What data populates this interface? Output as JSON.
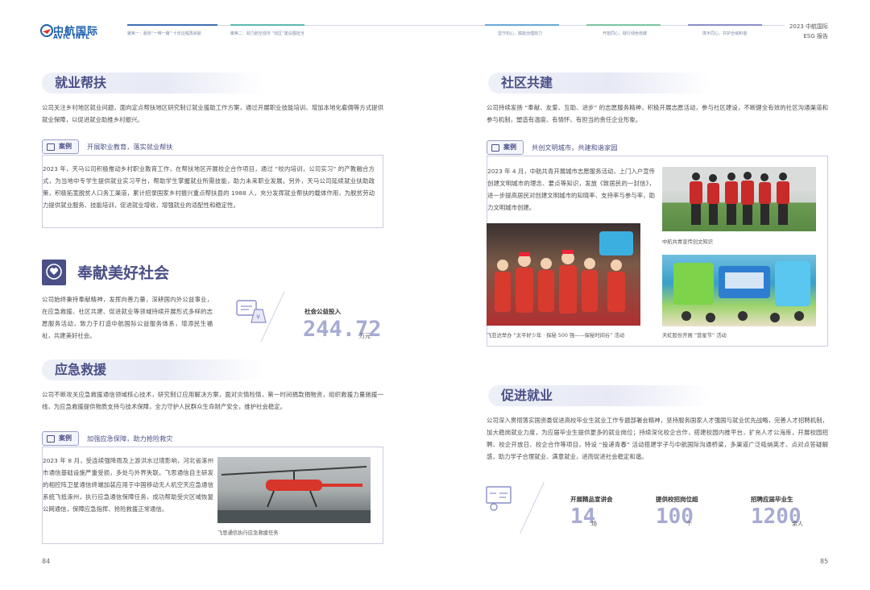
{
  "header": {
    "logo_cn": "中航国际",
    "logo_en": "AVIC INTL",
    "report_year": "2023 中航国际",
    "report_name": "ESG 报告",
    "nav": [
      {
        "label": "聚焦一：服务“一带一路” 十年征程再启航",
        "color": "#3f6fb4"
      },
      {
        "label": "聚焦二：助力航空强市 “双区”建设展担当",
        "color": "#5bb8b0"
      },
      {
        "label": "坚守初心，赋能治理效力",
        "color": "#6aa9d8"
      },
      {
        "label": "开拓同心，践行绿色低碳",
        "color": "#7cc4a2"
      },
      {
        "label": "携手同心，共护全域和谐",
        "color": "#8b8fc9"
      }
    ]
  },
  "left": {
    "employment_help": {
      "title": "就业帮扶",
      "intro": "公司关注乡村地区就业问题，面向定点帮扶地区研究制订就业援助工作方案，通过开展职业技能培训、增加本地化雇佣等方式提供就业保障，以促进就业助推乡村振兴。",
      "case_tag": "案例",
      "case_title": "开展职业教育，落实就业帮扶",
      "case_text": "2023 年，天马公司积极推动乡村职业教育工作，在帮扶地区开展校企合作项目，通过 “校内培训，公司实习” 的产教融合方式，为当地中专学生提供就业实习平台，帮助学生掌握就业所需技能，助力未来职业发展。另外，天马公司延续就业扶助政策，积极拓宽脱贫人口务工渠道，累计招录国家乡村振兴重点帮扶县的 1988 人，充分发挥就业帮扶的载体作用，为脱贫劳动力提供就业服务、技能培训，促进就业增收，增强就业的适配性和稳定性。"
    },
    "society": {
      "title": "奉献美好社会",
      "intro": "公司始终秉持奉献精神，发挥向善力量，深耕国内外公益事业，在应急救援、社区共建、促进就业等领域持续开展形式多样的志愿服务活动，致力于打造中航国际公益服务体系，增添民生福祉，共建美好社会。",
      "stat_label": "社会公益投入",
      "stat_value": "244.72",
      "stat_unit": "万元"
    },
    "emergency": {
      "title": "应急救援",
      "intro": "公司不断攻关应急救援通信领域核心技术，研究制订应用解决方案，面对灾情险情，第一时间捐款捐物资，组织救援力量驰援一线，为应急救援提供物质支持与技术保障，全力守护人民群众生命财产安全，维护社会稳定。",
      "case_tag": "案例",
      "case_title": "加强应急保障，助力抢险救灾",
      "case_text": "2023 年 8 月，受连续强降雨及上游洪水过境影响，河北省涿州市通信基础设施严重受损，多处与外界失联。飞思通信自主研发的相控阵卫星通信终端加装应用于中国移动无人机空天应急通信系统飞抵涿州，执行应急通信保障任务，成功帮助受灾区域恢复公网通信，保障应急指挥、抢险救援正常通信。",
      "photo_caption": "飞思通信执行应急救援任务"
    },
    "page_number": "84"
  },
  "right": {
    "community": {
      "title": "社区共建",
      "intro": "公司持续发扬 “奉献、友爱、互助、进步” 的志愿服务精神，积极开展志愿活动，参与社区建设，不断健全有效的社区沟通渠道和参与机制，塑造有温度、有情怀、有担当的责任企业形象。",
      "case_tag": "案例",
      "case_title": "共创文明城市，共建和谐家园",
      "case_text": "2023 年 4 月，中航共青开展城市志愿服务活动，上门入户宣传创建文明城市的理念、要点等知识，发放《致居民的一封信》，进一步提高居民对创建文明城市的知晓率、支持率与参与率，助力文明城市创建。",
      "caption_1": "中航共青宣传创文知识",
      "caption_2": "飞亚达举办 “太平好少年 · 探秘 500 强——探秘时间谷” 活动",
      "caption_3": "天虹股份开展 “营星节” 活动"
    },
    "promote": {
      "title": "促进就业",
      "intro": "公司深入贯彻落实国资委促进高校毕业生就业工作专题部署会精神，坚持服务国家人才强国与就业优先战略，完善人才招聘机制，加大稳岗就业力度，为应届毕业生提供更多的就业岗位；持续深化校企合作，搭建校园内推平台，扩充人才公海库，开展校园招聘、校企开放日、校企合作等项目，特设 “投递青春” 活动搭建学子与中航国际沟通桥梁，多渠道广泛吸纳英才、点对点答疑解惑，助力学子合理就业、满意就业，进而促进社会稳定和谐。",
      "stats": [
        {
          "label": "开展精品宣讲会",
          "value": "14",
          "unit": "场"
        },
        {
          "label": "提供校招岗位超",
          "value": "100",
          "unit": "个"
        },
        {
          "label": "招聘应届毕业生",
          "value": "1200",
          "unit": "余人"
        }
      ]
    },
    "page_number": "85"
  },
  "colors": {
    "accent": "#4a4f86",
    "stat": "#a7abd3",
    "brand": "#1b5fae"
  }
}
